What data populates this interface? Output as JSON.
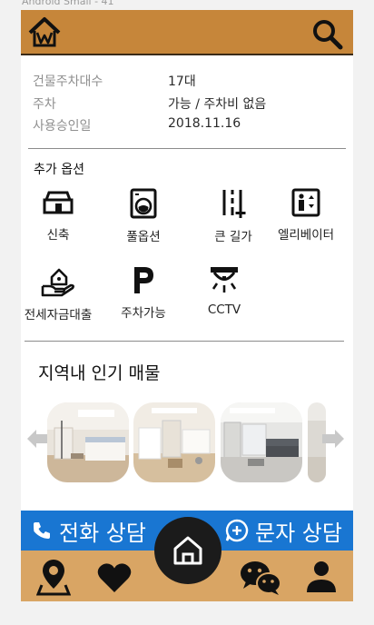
{
  "frame_label": "Android Small - 41",
  "colors": {
    "topbar": "#c6863a",
    "callbar": "#1976d2",
    "bottombar": "#d9a564",
    "home_button": "#1b1b1b"
  },
  "header": {
    "logo_icon": "house-w-logo-icon",
    "search_icon": "search-icon"
  },
  "info": [
    {
      "key": "건물주차대수",
      "value": "17대"
    },
    {
      "key": "주차",
      "value": "가능 / 주차비 없음"
    },
    {
      "key": "사용승인일",
      "value": "2018.11.16"
    }
  ],
  "options": {
    "title": "추가 옵션",
    "items": [
      {
        "label": "신축",
        "icon": "new-building-icon"
      },
      {
        "label": "풀옵션",
        "icon": "washing-machine-icon"
      },
      {
        "label": "큰 길가",
        "icon": "road-icon"
      },
      {
        "label": "엘리베이터",
        "icon": "elevator-icon"
      },
      {
        "label": "전세자금대출",
        "icon": "hand-house-icon"
      },
      {
        "label": "주차가능",
        "icon": "parking-icon"
      },
      {
        "label": "CCTV",
        "icon": "cctv-icon"
      }
    ]
  },
  "popular": {
    "title": "지역내 인기 매물",
    "thumbnails": [
      "bedroom-photo",
      "studio-photo",
      "living-room-photo",
      "partial-photo"
    ]
  },
  "actions": {
    "call_label": "전화 상담",
    "message_label": "문자 상담"
  },
  "bottom_nav": [
    "map-pin-icon",
    "heart-icon",
    "home-icon",
    "chat-icon",
    "user-icon"
  ]
}
